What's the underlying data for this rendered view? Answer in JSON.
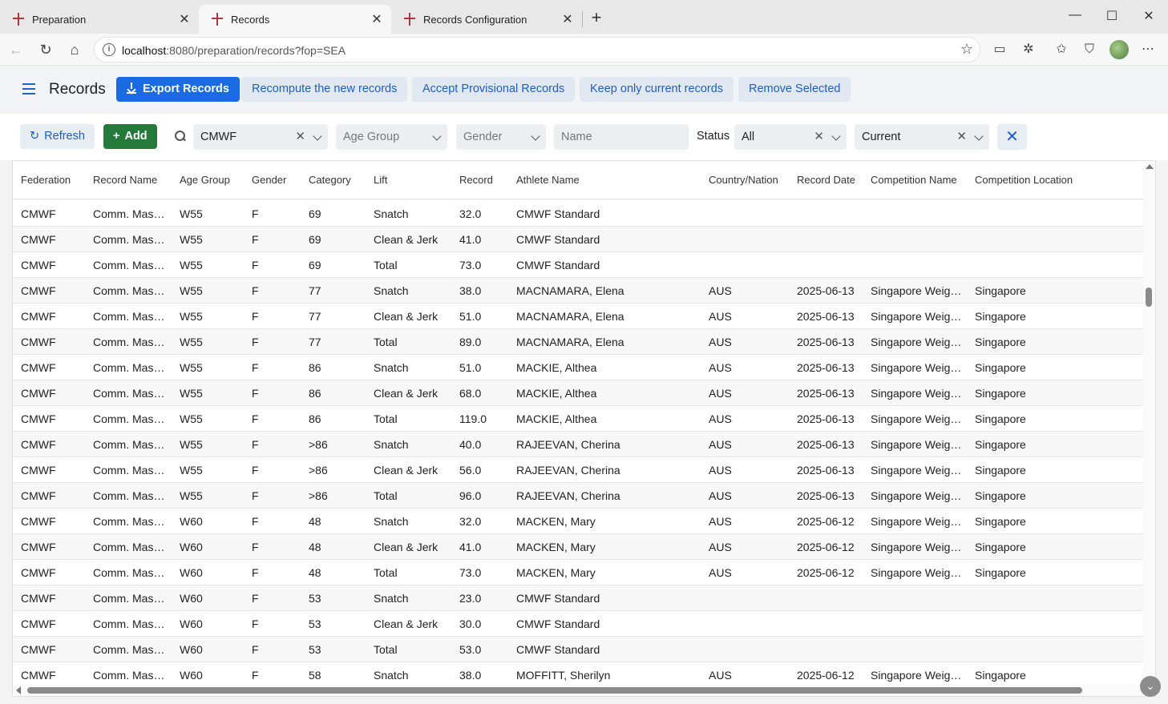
{
  "browser": {
    "tabs": [
      {
        "label": "Preparation",
        "active": false
      },
      {
        "label": "Records",
        "active": true
      },
      {
        "label": "Records Configuration",
        "active": false
      }
    ],
    "url_host": "localhost",
    "url_rest": ":8080/preparation/records?fop=SEA"
  },
  "header": {
    "title": "Records",
    "export_label": "Export Records",
    "recompute_label": "Recompute the new records",
    "accept_label": "Accept Provisional Records",
    "keep_label": "Keep only current records",
    "remove_label": "Remove Selected"
  },
  "filters": {
    "refresh_label": "Refresh",
    "add_label": "Add",
    "federation_value": "CMWF",
    "age_group_placeholder": "Age Group",
    "gender_placeholder": "Gender",
    "name_placeholder": "Name",
    "status_label": "Status",
    "status_value": "All",
    "current_value": "Current"
  },
  "table": {
    "columns": [
      "Federation",
      "Record Name",
      "Age Group",
      "Gender",
      "Category",
      "Lift",
      "Record",
      "Athlete Name",
      "Country/Nation",
      "Record Date",
      "Competition Name",
      "Competition Location"
    ],
    "rows": [
      [
        "CMWF",
        "Comm. Mas…",
        "W55",
        "F",
        "69",
        "Snatch",
        "32.0",
        "CMWF Standard",
        "",
        "",
        "",
        ""
      ],
      [
        "CMWF",
        "Comm. Mas…",
        "W55",
        "F",
        "69",
        "Clean & Jerk",
        "41.0",
        "CMWF Standard",
        "",
        "",
        "",
        ""
      ],
      [
        "CMWF",
        "Comm. Mas…",
        "W55",
        "F",
        "69",
        "Total",
        "73.0",
        "CMWF Standard",
        "",
        "",
        "",
        ""
      ],
      [
        "CMWF",
        "Comm. Mas…",
        "W55",
        "F",
        "77",
        "Snatch",
        "38.0",
        "MACNAMARA, Elena",
        "AUS",
        "2025-06-13",
        "Singapore Weig…",
        "Singapore"
      ],
      [
        "CMWF",
        "Comm. Mas…",
        "W55",
        "F",
        "77",
        "Clean & Jerk",
        "51.0",
        "MACNAMARA, Elena",
        "AUS",
        "2025-06-13",
        "Singapore Weig…",
        "Singapore"
      ],
      [
        "CMWF",
        "Comm. Mas…",
        "W55",
        "F",
        "77",
        "Total",
        "89.0",
        "MACNAMARA, Elena",
        "AUS",
        "2025-06-13",
        "Singapore Weig…",
        "Singapore"
      ],
      [
        "CMWF",
        "Comm. Mas…",
        "W55",
        "F",
        "86",
        "Snatch",
        "51.0",
        "MACKIE, Althea",
        "AUS",
        "2025-06-13",
        "Singapore Weig…",
        "Singapore"
      ],
      [
        "CMWF",
        "Comm. Mas…",
        "W55",
        "F",
        "86",
        "Clean & Jerk",
        "68.0",
        "MACKIE, Althea",
        "AUS",
        "2025-06-13",
        "Singapore Weig…",
        "Singapore"
      ],
      [
        "CMWF",
        "Comm. Mas…",
        "W55",
        "F",
        "86",
        "Total",
        "119.0",
        "MACKIE, Althea",
        "AUS",
        "2025-06-13",
        "Singapore Weig…",
        "Singapore"
      ],
      [
        "CMWF",
        "Comm. Mas…",
        "W55",
        "F",
        ">86",
        "Snatch",
        "40.0",
        "RAJEEVAN, Cherina",
        "AUS",
        "2025-06-13",
        "Singapore Weig…",
        "Singapore"
      ],
      [
        "CMWF",
        "Comm. Mas…",
        "W55",
        "F",
        ">86",
        "Clean & Jerk",
        "56.0",
        "RAJEEVAN, Cherina",
        "AUS",
        "2025-06-13",
        "Singapore Weig…",
        "Singapore"
      ],
      [
        "CMWF",
        "Comm. Mas…",
        "W55",
        "F",
        ">86",
        "Total",
        "96.0",
        "RAJEEVAN, Cherina",
        "AUS",
        "2025-06-13",
        "Singapore Weig…",
        "Singapore"
      ],
      [
        "CMWF",
        "Comm. Mas…",
        "W60",
        "F",
        "48",
        "Snatch",
        "32.0",
        "MACKEN, Mary",
        "AUS",
        "2025-06-12",
        "Singapore Weig…",
        "Singapore"
      ],
      [
        "CMWF",
        "Comm. Mas…",
        "W60",
        "F",
        "48",
        "Clean & Jerk",
        "41.0",
        "MACKEN, Mary",
        "AUS",
        "2025-06-12",
        "Singapore Weig…",
        "Singapore"
      ],
      [
        "CMWF",
        "Comm. Mas…",
        "W60",
        "F",
        "48",
        "Total",
        "73.0",
        "MACKEN, Mary",
        "AUS",
        "2025-06-12",
        "Singapore Weig…",
        "Singapore"
      ],
      [
        "CMWF",
        "Comm. Mas…",
        "W60",
        "F",
        "53",
        "Snatch",
        "23.0",
        "CMWF Standard",
        "",
        "",
        "",
        ""
      ],
      [
        "CMWF",
        "Comm. Mas…",
        "W60",
        "F",
        "53",
        "Clean & Jerk",
        "30.0",
        "CMWF Standard",
        "",
        "",
        "",
        ""
      ],
      [
        "CMWF",
        "Comm. Mas…",
        "W60",
        "F",
        "53",
        "Total",
        "53.0",
        "CMWF Standard",
        "",
        "",
        "",
        ""
      ],
      [
        "CMWF",
        "Comm. Mas…",
        "W60",
        "F",
        "58",
        "Snatch",
        "38.0",
        "MOFFITT, Sherilyn",
        "AUS",
        "2025-06-12",
        "Singapore Weig…",
        "Singapore"
      ]
    ]
  },
  "colors": {
    "primary": "#1a6ae3",
    "add_green": "#237a3a",
    "link_blue": "#1b5fc7"
  }
}
